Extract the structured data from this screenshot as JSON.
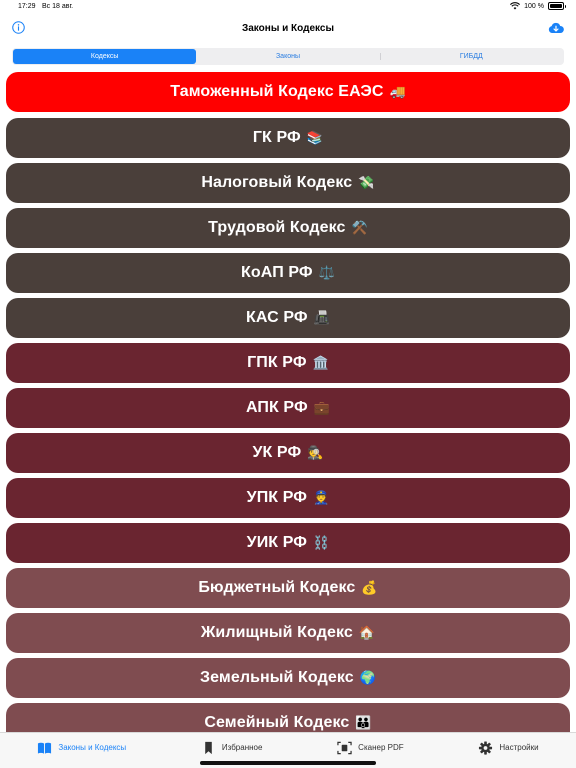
{
  "status": {
    "time": "17:29",
    "date": "Вс 18 авг.",
    "battery": "100 %"
  },
  "nav": {
    "title": "Законы и Кодексы"
  },
  "segments": [
    {
      "label": "Кодексы",
      "active": true
    },
    {
      "label": "Законы",
      "active": false
    },
    {
      "label": "ГИБДД",
      "active": false
    }
  ],
  "items": [
    {
      "label": "Таможенный Кодекс ЕАЭС",
      "emoji": "🚚",
      "color": "#ff0000"
    },
    {
      "label": "ГК РФ",
      "emoji": "📚",
      "color": "#4a3f3a"
    },
    {
      "label": "Налоговый Кодекс",
      "emoji": "💸",
      "color": "#4a3f3a"
    },
    {
      "label": "Трудовой Кодекс",
      "emoji": "⚒️",
      "color": "#4a3f3a"
    },
    {
      "label": "КоАП РФ",
      "emoji": "⚖️",
      "color": "#4a3f3a"
    },
    {
      "label": "КАС РФ",
      "emoji": "📠",
      "color": "#4a3f3a"
    },
    {
      "label": "ГПК РФ",
      "emoji": "🏛️",
      "color": "#6a2530"
    },
    {
      "label": "АПК РФ",
      "emoji": "💼",
      "color": "#6a2530"
    },
    {
      "label": "УК РФ",
      "emoji": "🕵️",
      "color": "#6a2530"
    },
    {
      "label": "УПК РФ",
      "emoji": "👮",
      "color": "#6a2530"
    },
    {
      "label": "УИК РФ",
      "emoji": "⛓️",
      "color": "#6a2530"
    },
    {
      "label": "Бюджетный Кодекс",
      "emoji": "💰",
      "color": "#7f4c50"
    },
    {
      "label": "Жилищный Кодекс",
      "emoji": "🏠",
      "color": "#7f4c50"
    },
    {
      "label": "Земельный Кодекс",
      "emoji": "🌍",
      "color": "#7f4c50"
    },
    {
      "label": "Семейный Кодекс",
      "emoji": "👪",
      "color": "#7f4c50"
    }
  ],
  "tabs": [
    {
      "label": "Законы и Кодексы",
      "icon": "book-icon",
      "active": true
    },
    {
      "label": "Избранное",
      "icon": "bookmark-icon",
      "active": false
    },
    {
      "label": "Сканер PDF",
      "icon": "scanner-icon",
      "active": false
    },
    {
      "label": "Настройки",
      "icon": "gear-icon",
      "active": false
    }
  ],
  "colors": {
    "accent": "#1a82f7",
    "customs": "#ff0000",
    "codes_dark": "#4a3f3a",
    "codes_wine": "#6a2530",
    "codes_rose": "#7f4c50"
  }
}
